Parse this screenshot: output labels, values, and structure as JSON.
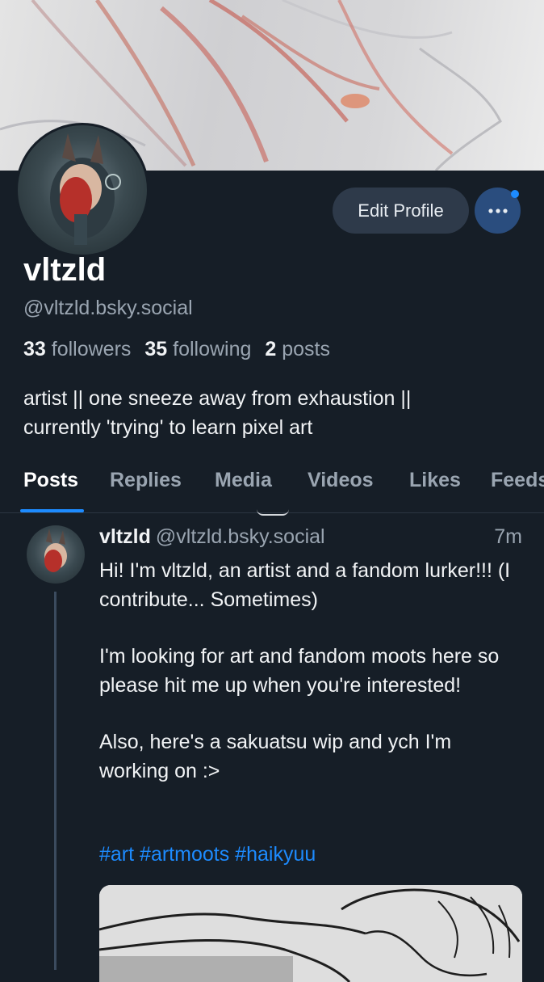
{
  "profile": {
    "display_name": "vltzld",
    "handle": "@vltzld.bsky.social",
    "followers_count": "33",
    "followers_label": "followers",
    "following_count": "35",
    "following_label": "following",
    "posts_count": "2",
    "posts_label": "posts",
    "bio_line1": "artist || one sneeze away from exhaustion ||",
    "bio_line2": "currently 'trying' to learn pixel art"
  },
  "actions": {
    "edit_profile_label": "Edit Profile",
    "more_icon": "ellipsis-icon",
    "notification_color": "#1d8bff"
  },
  "tabs": [
    {
      "label": "Posts",
      "active": true
    },
    {
      "label": "Replies",
      "active": false
    },
    {
      "label": "Media",
      "active": false
    },
    {
      "label": "Videos",
      "active": false
    },
    {
      "label": "Likes",
      "active": false
    },
    {
      "label": "Feeds",
      "active": false
    }
  ],
  "post": {
    "author": "vltzld",
    "handle": "@vltzld.bsky.social",
    "time": "7m",
    "paragraph1": "Hi! I'm vltzld, an artist and a fandom lurker!!! (I contribute... Sometimes)",
    "paragraph2": "I'm looking for art and fandom moots here so please hit me up when you're interested!",
    "paragraph3": "Also, here's a sakuatsu wip and ych I'm working on :>",
    "tags": [
      "#art",
      "#artmoots",
      "#haikyuu"
    ]
  },
  "colors": {
    "background": "#161e27",
    "accent": "#1d8bff",
    "muted_text": "#9aa5b1",
    "button_bg": "#2e3a4a"
  }
}
